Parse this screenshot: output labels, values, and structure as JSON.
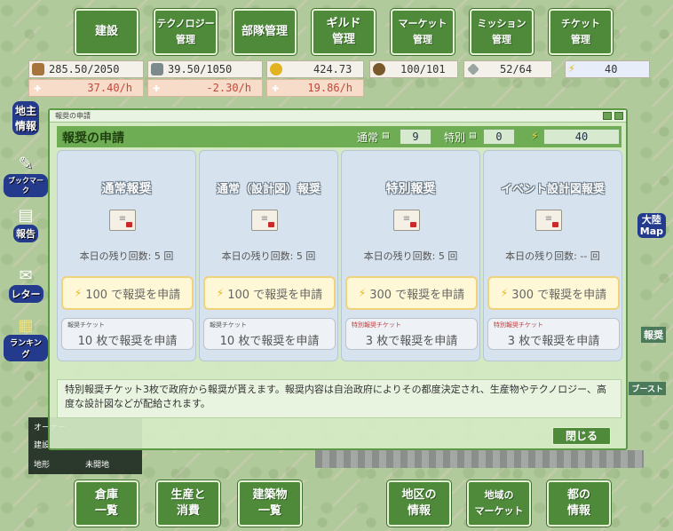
{
  "top_nav": [
    "建設",
    "テクノロジー\n管理",
    "部隊管理",
    "ギルド\n管理",
    "マーケット\n管理",
    "ミッション\n管理",
    "チケット\n管理"
  ],
  "bottom_nav": [
    "倉庫\n一覧",
    "生産と\n消費",
    "建築物\n一覧",
    "地区の\n情報",
    "地域の\nマーケット",
    "都の\n情報"
  ],
  "resources": {
    "r1": "285.50/2050",
    "r1_rate": "37.40/h",
    "r2": "39.50/1050",
    "r2_rate": "-2.30/h",
    "r3": "424.73",
    "r3_rate": "19.86/h",
    "r4": "100/101",
    "r5": "52/64",
    "r6": "40"
  },
  "left_side": [
    "地主\n情報",
    "ブックマーク",
    "報告",
    "レター",
    "ランキング"
  ],
  "right_side": [
    "大陸\nMap",
    "報奨",
    "ブースト"
  ],
  "dialog": {
    "window_title": "報奨の申請",
    "title": "報奨の申請",
    "normal_label": "通常",
    "normal_count": "9",
    "special_label": "特別",
    "special_count": "0",
    "energy_count": "40",
    "cards": [
      {
        "title": "通常報奨",
        "remaining": "本日の残り回数: 5 回",
        "cost": "100 で報奨を申請",
        "ticket_label": "報奨チケット",
        "ticket": "10 枚で報奨を申請"
      },
      {
        "title": "通常（設計図）報奨",
        "remaining": "本日の残り回数: 5 回",
        "cost": "100 で報奨を申請",
        "ticket_label": "報奨チケット",
        "ticket": "10 枚で報奨を申請"
      },
      {
        "title": "特別報奨",
        "remaining": "本日の残り回数: 5 回",
        "cost": "300 で報奨を申請",
        "ticket_label": "特別報奨チケット",
        "ticket": "3 枚で報奨を申請"
      },
      {
        "title": "イベント設計図報奨",
        "remaining": "本日の残り回数: -- 回",
        "cost": "300 で報奨を申請",
        "ticket_label": "特別報奨チケット",
        "ticket": "3 枚で報奨を申請"
      }
    ],
    "description": "特別報奨チケット3枚で政府から報奨が貰えます。報奨内容は自治政府によりその都度決定され、生産物やテクノロジー、高度な設計図などが配給されます。",
    "close_label": "閉じる"
  },
  "owner": {
    "row1": "オーナー",
    "row2": "建設",
    "row3_label": "地形",
    "row3_value": "未開地"
  }
}
